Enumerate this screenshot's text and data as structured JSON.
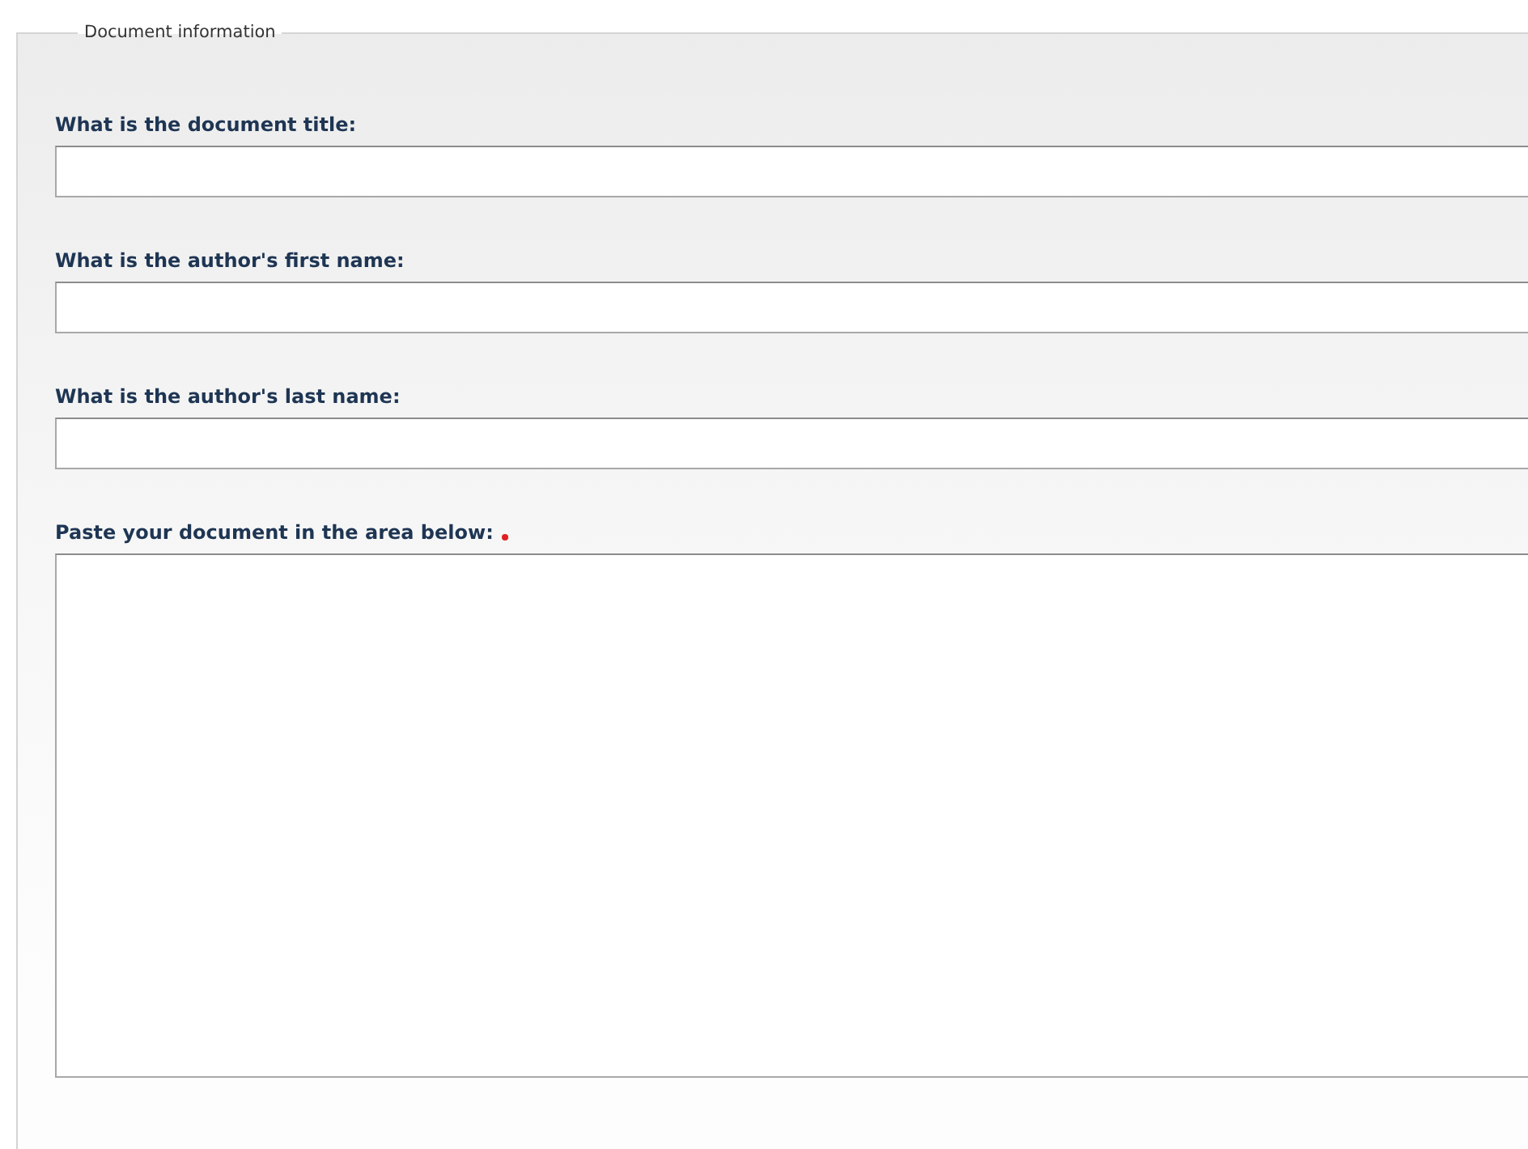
{
  "legend": "Document information",
  "fields": [
    {
      "kind": "text",
      "label": "What is the document title:",
      "required": false
    },
    {
      "kind": "text",
      "label": "What is the author's first name:",
      "required": false
    },
    {
      "kind": "text",
      "label": "What is the author's last name:",
      "required": false
    },
    {
      "kind": "textarea",
      "label": "Paste your document in the area below:",
      "required": true
    }
  ]
}
